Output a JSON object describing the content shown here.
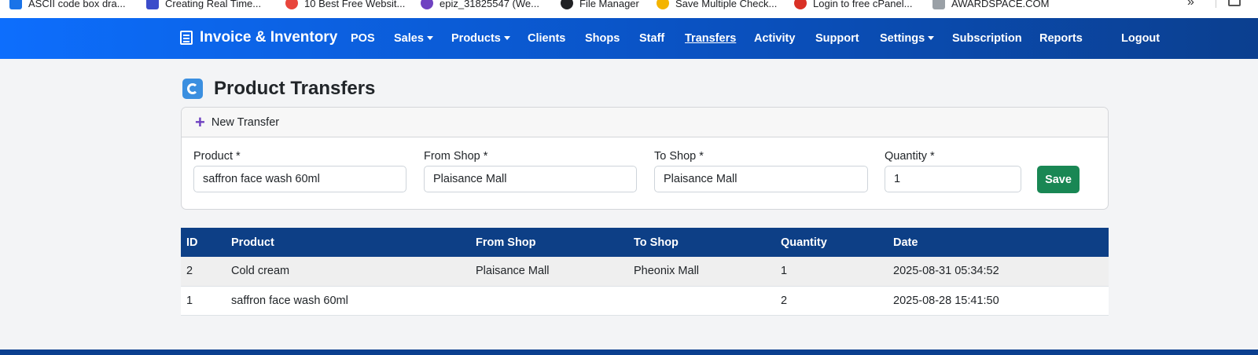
{
  "bookmarks": [
    {
      "label": "ASCII code box dra...",
      "color": "#1a73e8"
    },
    {
      "label": "Creating Real Time...",
      "color": "#3b4cca"
    },
    {
      "label": "10 Best Free Websit...",
      "color": "#e8453c"
    },
    {
      "label": "epiz_31825547 (We...",
      "color": "#6f42c1"
    },
    {
      "label": "File Manager",
      "color": "#202124"
    },
    {
      "label": "Save Multiple Check...",
      "color": "#f4b400"
    },
    {
      "label": "Login to free cPanel...",
      "color": "#d93025"
    },
    {
      "label": "AWARDSPACE.COM",
      "color": "#9aa0a6"
    }
  ],
  "bookmarks_overflow": "»",
  "navbar": {
    "brand": "Invoice & Inventory",
    "items": [
      {
        "label": "POS"
      },
      {
        "label": "Sales"
      },
      {
        "label": "Products"
      },
      {
        "label": "Clients"
      },
      {
        "label": "Shops"
      },
      {
        "label": "Staff"
      },
      {
        "label": "Transfers"
      },
      {
        "label": "Activity"
      },
      {
        "label": "Support"
      },
      {
        "label": "Settings"
      },
      {
        "label": "Subscription"
      },
      {
        "label": "Reports"
      },
      {
        "label": "Logout"
      }
    ]
  },
  "page": {
    "title": "Product Transfers"
  },
  "form": {
    "header": "New Transfer",
    "product_label": "Product *",
    "product_value": "saffron face wash 60ml",
    "from_label": "From Shop *",
    "from_value": "Plaisance Mall",
    "to_label": "To Shop *",
    "to_value": "Plaisance Mall",
    "qty_label": "Quantity *",
    "qty_value": "1",
    "save_label": "Save"
  },
  "table": {
    "headers": [
      "ID",
      "Product",
      "From Shop",
      "To Shop",
      "Quantity",
      "Date"
    ],
    "rows": [
      [
        "2",
        "Cold cream",
        "Plaisance Mall",
        "Pheonix Mall",
        "1",
        "2025-08-31 05:34:52"
      ],
      [
        "1",
        "saffron face wash 60ml",
        "",
        "",
        "2",
        "2025-08-28 15:41:50"
      ]
    ]
  },
  "colors": {
    "navbar_start": "#0d6efd",
    "navbar_end": "#0b3f8f",
    "table_header": "#0d3f86",
    "save_button": "#198754",
    "plus_icon": "#6f42c1"
  }
}
